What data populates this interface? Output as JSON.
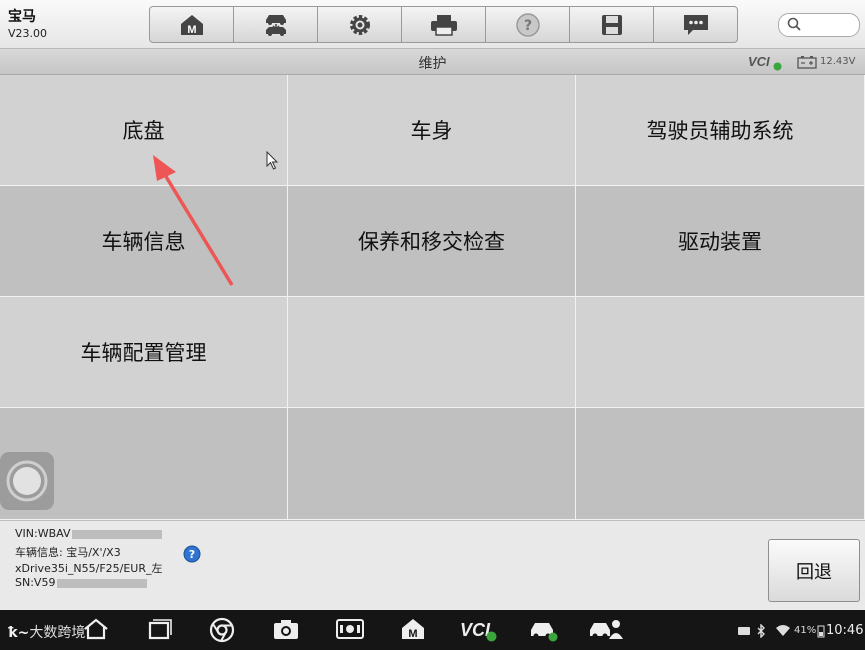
{
  "app": {
    "name": "宝马",
    "version": "V23.00"
  },
  "toolbar": {
    "buttons": [
      {
        "name": "home",
        "icon": "home-m-icon"
      },
      {
        "name": "vehicle-swap",
        "icon": "vehicle-swap-icon"
      },
      {
        "name": "settings",
        "icon": "gear-icon"
      },
      {
        "name": "print",
        "icon": "printer-icon"
      },
      {
        "name": "help",
        "icon": "question-circle-icon"
      },
      {
        "name": "save",
        "icon": "floppy-disk-icon"
      },
      {
        "name": "feedback",
        "icon": "message-icon"
      }
    ],
    "search_icon": "search-icon"
  },
  "title_bar": {
    "title": "维护",
    "vci": "VCI",
    "voltage": "12.43V"
  },
  "menu": {
    "items": [
      "底盘",
      "车身",
      "驾驶员辅助系统",
      "车辆信息",
      "保养和移交检查",
      "驱动装置",
      "车辆配置管理"
    ]
  },
  "footer": {
    "vin": "VIN:WBAV",
    "vehicle_info": "车辆信息: 宝马/X'/X3",
    "drive": "xDrive35i_N55/F25/EUR_左",
    "sn": "SN:V59",
    "back_label": "回退"
  },
  "navbar": {
    "watermark": "大数跨境",
    "vci": "VCI",
    "battery": "41%",
    "time": "10:46"
  },
  "colors": {
    "accent_arrow": "#ee5555",
    "help_blue": "#2f74d0",
    "vci_green": "#3aa53a"
  }
}
